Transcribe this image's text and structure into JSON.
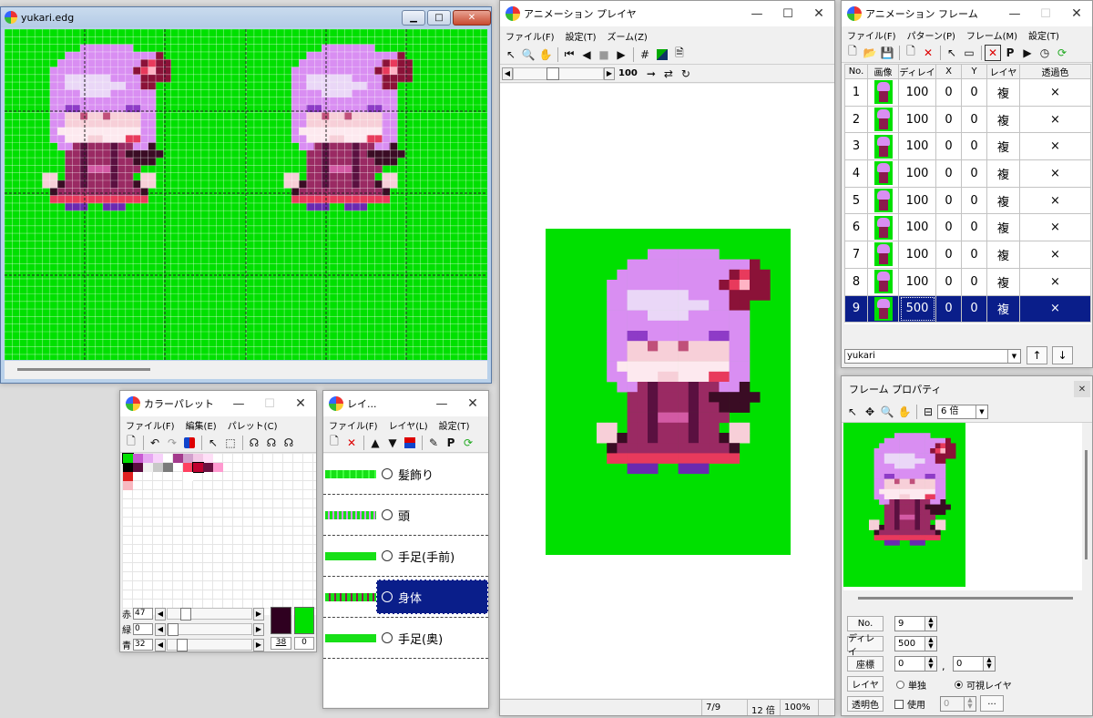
{
  "editor": {
    "title": "yukari.edg"
  },
  "palette_win": {
    "title": "カラーパレット",
    "menu": [
      "ファイル(F)",
      "編集(E)",
      "パレット(C)"
    ],
    "sliders": [
      {
        "label": "赤",
        "value": "47",
        "level": 0.18
      },
      {
        "label": "緑",
        "value": "0",
        "level": 0.0
      },
      {
        "label": "青",
        "value": "32",
        "level": 0.13
      }
    ],
    "index_a": "38",
    "index_b": "0",
    "colors": {
      "current": "#2f0020",
      "transparent": "#00e000"
    },
    "swatches": [
      "#00e000",
      "#c85ad2",
      "#e6a7f2",
      "#f7d2fa",
      "#a33a8c",
      "#d2a0cc",
      "#f3c8e6",
      "#ffdff7",
      "#000000",
      "#5b0b40",
      "#f0f0f0",
      "#c8c8c8",
      "#7a7a7a",
      "#ff4060",
      "#c00030",
      "#6a1040",
      "#e02020",
      "#f8b8c0",
      "#ffffff",
      "#ff9ad0"
    ]
  },
  "layer_win": {
    "title": "レイ...",
    "menu": [
      "ファイル(F)",
      "レイヤ(L)",
      "設定(T)"
    ],
    "layers": [
      "髪飾り",
      "頭",
      "手足(手前)",
      "身体",
      "手足(奥)"
    ],
    "selected": 3
  },
  "player": {
    "title": "アニメーション プレイヤ",
    "menu": [
      "ファイル(F)",
      "設定(T)",
      "ズーム(Z)"
    ],
    "frame_value": "100",
    "status": [
      "7/9",
      "12 倍",
      "100%"
    ]
  },
  "frames_win": {
    "title": "アニメーション フレーム",
    "menu": [
      "ファイル(F)",
      "パターン(P)",
      "フレーム(M)",
      "設定(T)"
    ],
    "columns": [
      "No.",
      "画像",
      "ディレイ",
      "X",
      "Y",
      "レイヤ",
      "透過色"
    ],
    "rows": [
      {
        "no": "1",
        "delay": "100",
        "x": "0",
        "y": "0",
        "layer": "複",
        "trans": "×"
      },
      {
        "no": "2",
        "delay": "100",
        "x": "0",
        "y": "0",
        "layer": "複",
        "trans": "×"
      },
      {
        "no": "3",
        "delay": "100",
        "x": "0",
        "y": "0",
        "layer": "複",
        "trans": "×"
      },
      {
        "no": "4",
        "delay": "100",
        "x": "0",
        "y": "0",
        "layer": "複",
        "trans": "×"
      },
      {
        "no": "5",
        "delay": "100",
        "x": "0",
        "y": "0",
        "layer": "複",
        "trans": "×"
      },
      {
        "no": "6",
        "delay": "100",
        "x": "0",
        "y": "0",
        "layer": "複",
        "trans": "×"
      },
      {
        "no": "7",
        "delay": "100",
        "x": "0",
        "y": "0",
        "layer": "複",
        "trans": "×"
      },
      {
        "no": "8",
        "delay": "100",
        "x": "0",
        "y": "0",
        "layer": "複",
        "trans": "×"
      },
      {
        "no": "9",
        "delay": "500",
        "x": "0",
        "y": "0",
        "layer": "複",
        "trans": "×"
      }
    ],
    "selected_row": 8,
    "pattern": "yukari"
  },
  "props": {
    "title": "フレーム プロパティ",
    "zoom": "6 倍",
    "labels": {
      "no": "No.",
      "delay": "ディレイ",
      "coord": "座標",
      "layer": "レイヤ",
      "trans": "透明色"
    },
    "no": "9",
    "delay": "500",
    "x": "0",
    "y": "0",
    "layer_single": "単独",
    "layer_visible": "可視レイヤ",
    "use_label": "使用",
    "trans_value": "0",
    "dots": "..."
  }
}
